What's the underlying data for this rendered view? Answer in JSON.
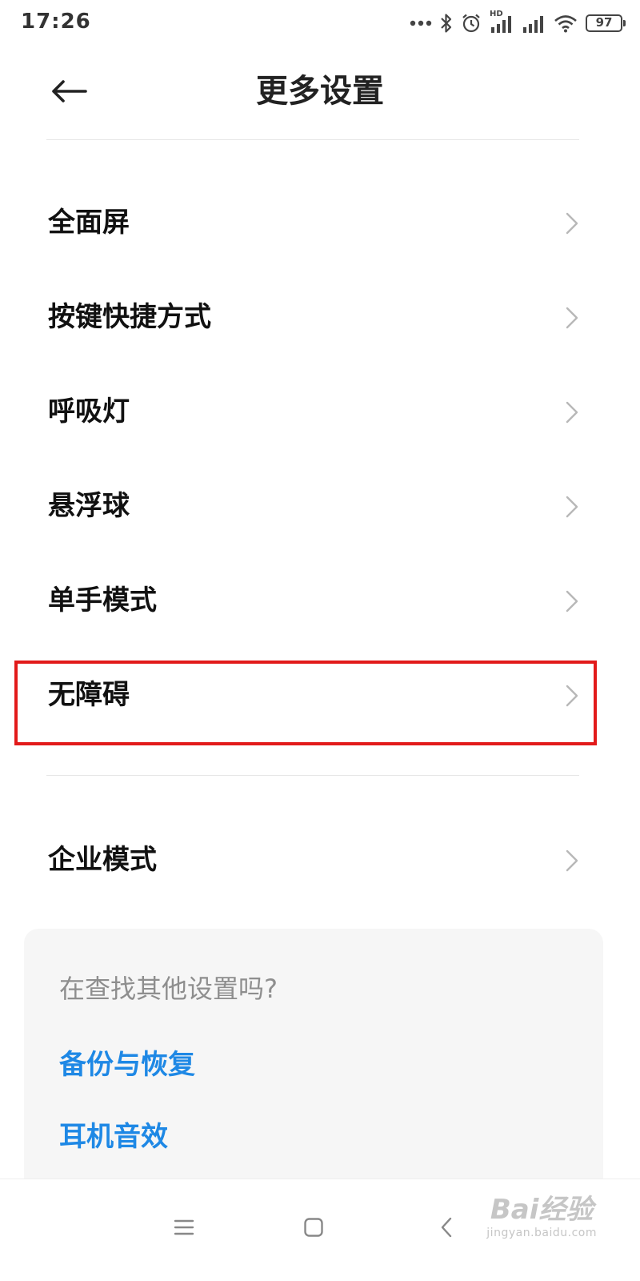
{
  "status_bar": {
    "time": "17:26",
    "battery": "97",
    "network_label": "HD",
    "icons": [
      "more-dots-icon",
      "bluetooth-icon",
      "alarm-icon",
      "signal-hd-icon",
      "signal-icon",
      "wifi-icon",
      "battery-icon"
    ]
  },
  "header": {
    "title": "更多设置",
    "back_icon": "back-arrow-icon"
  },
  "list": {
    "items": [
      {
        "label": "全面屏"
      },
      {
        "label": "按键快捷方式"
      },
      {
        "label": "呼吸灯"
      },
      {
        "label": "悬浮球"
      },
      {
        "label": "单手模式"
      },
      {
        "label": "无障碍",
        "highlighted": true
      },
      {
        "label": "企业模式"
      }
    ]
  },
  "suggestions": {
    "title": "在查找其他设置吗?",
    "links": [
      "备份与恢复",
      "耳机音效"
    ]
  },
  "nav_bar": {
    "icons": [
      "menu-icon",
      "home-icon",
      "back-icon"
    ]
  },
  "watermark": {
    "main": "Bai经验",
    "sub": "jingyan.baidu.com"
  },
  "colors": {
    "highlight": "#e21a1a",
    "link": "#1e88e5",
    "card_background": "#f6f6f6"
  }
}
